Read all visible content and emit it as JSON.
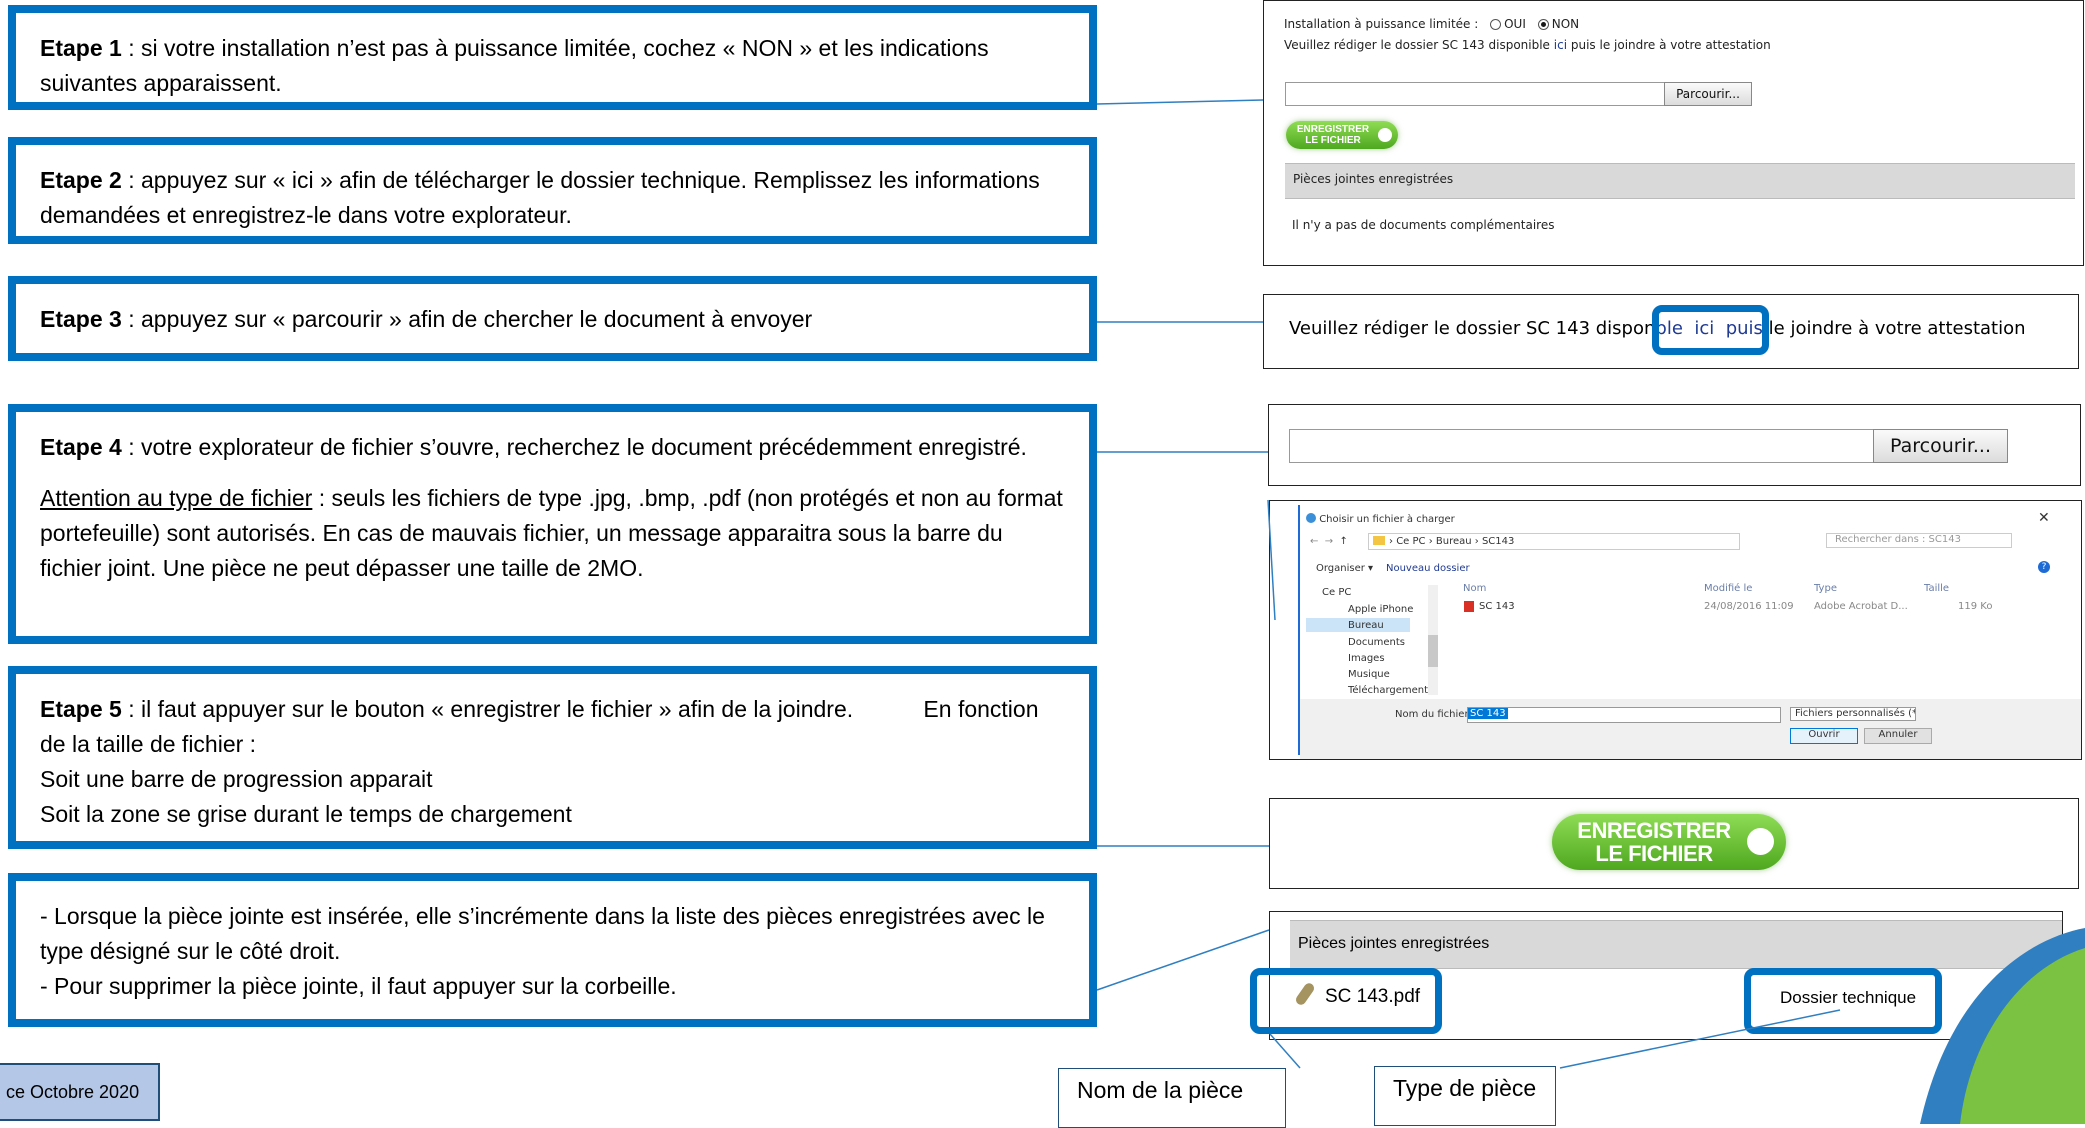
{
  "steps": [
    {
      "label": "Etape 1",
      "text": " : si votre installation n’est pas à puissance limitée, cochez « NON » et les indications suivantes apparaissent."
    },
    {
      "label": "Etape 2",
      "text": " : appuyez sur « ici » afin de télécharger le dossier technique. Remplissez les informations demandées et enregistrez-le dans votre explorateur."
    },
    {
      "label": "Etape 3",
      "text": " : appuyez sur « parcourir » afin de chercher le document à envoyer"
    },
    {
      "label": "Etape 4",
      "text": " : votre explorateur de fichier s’ouvre, recherchez le document précédemment enregistré.",
      "warning_title": "Attention au type de fichier",
      "warning_text": " : seuls les fichiers de type .jpg, .bmp, .pdf (non protégés et non au format portefeuille) sont autorisés. En cas de mauvais fichier, un message apparaitra sous la barre du fichier joint. Une pièce ne peut dépasser une taille de 2MO."
    },
    {
      "label": "Etape 5",
      "text": " : il faut appuyer sur le bouton « enregistrer le fichier » afin de la joindre.           En fonction de la taille de fichier :",
      "line2": "Soit une barre de progression apparait",
      "line3": "Soit la zone se grise durant le temps de chargement"
    },
    {
      "line1": "- Lorsque la pièce jointe est insérée, elle s’incrémente dans la liste des pièces enregistrées avec le type désigné sur le côté droit.",
      "line2": "- Pour supprimer la pièce jointe, il faut appuyer sur la corbeille."
    }
  ],
  "footer": {
    "date_label": "ce Octobre 2020"
  },
  "form": {
    "question": "Installation à puissance limitée :",
    "opt_oui": "OUI",
    "opt_non": "NON",
    "instr_before": "Veuillez rédiger le dossier SC 143 disponible",
    "instr_link": "ici",
    "instr_after": "puis le joindre à votre attestation",
    "browse": "Parcourir...",
    "save_btn_line1": "ENREGISTRER",
    "save_btn_line2": "LE FICHIER",
    "attachments_header": "Pièces jointes enregistrées",
    "no_docs": "Il n'y a pas de documents complémentaires"
  },
  "zoom_instruction": {
    "before": "Veuillez rédiger le dossier SC 143 dispon",
    "link_area": "ble  ici  puis",
    "after": " le joindre à votre attestation"
  },
  "dialog": {
    "title": "Choisir un fichier à charger",
    "path": [
      "Ce PC",
      "Bureau",
      "SC143"
    ],
    "search_placeholder": "Rechercher dans : SC143",
    "organize": "Organiser ▾",
    "new_folder": "Nouveau dossier",
    "tree": [
      "Ce PC",
      "Apple iPhone",
      "Bureau",
      "Documents",
      "Images",
      "Musique",
      "Téléchargement"
    ],
    "columns": [
      "Nom",
      "Modifié le",
      "Type",
      "Taille"
    ],
    "file": {
      "name": "SC 143",
      "date": "24/08/2016 11:09",
      "type": "Adobe Acrobat D...",
      "size": "119 Ko"
    },
    "filename_label": "Nom du fichier :",
    "filename_value": "SC 143",
    "filter": "Fichiers personnalisés (*.PDF;*.J",
    "open": "Ouvrir",
    "cancel": "Annuler"
  },
  "attachment_row": {
    "header": "Pièces jointes enregistrées",
    "name": "SC 143.pdf",
    "type": "Dossier technique"
  },
  "callouts": {
    "name": "Nom de la pièce",
    "type": "Type de pièce"
  },
  "colors": {
    "frame_blue": "#0070c0",
    "link_blue": "#1f3a93",
    "button_green": "#5cb82b",
    "grey_band": "#d9d9d9"
  }
}
